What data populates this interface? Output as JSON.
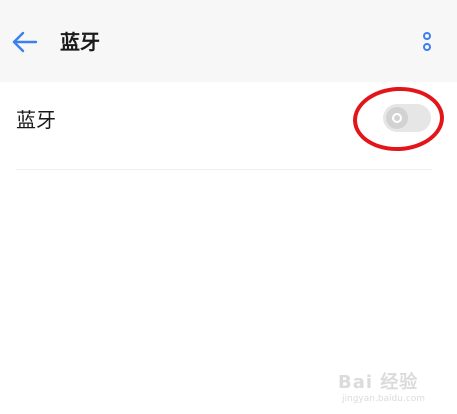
{
  "header": {
    "title": "蓝牙",
    "back_icon": "arrow-left-icon",
    "more_icon": "more-vertical-icon",
    "accent_color": "#3b7ff0"
  },
  "settings": {
    "bluetooth": {
      "label": "蓝牙",
      "enabled": false
    }
  },
  "annotation": {
    "highlight_color": "#e3151a"
  },
  "watermark": {
    "logo": "Bai 经验",
    "url": "jingyan.baidu.com"
  }
}
